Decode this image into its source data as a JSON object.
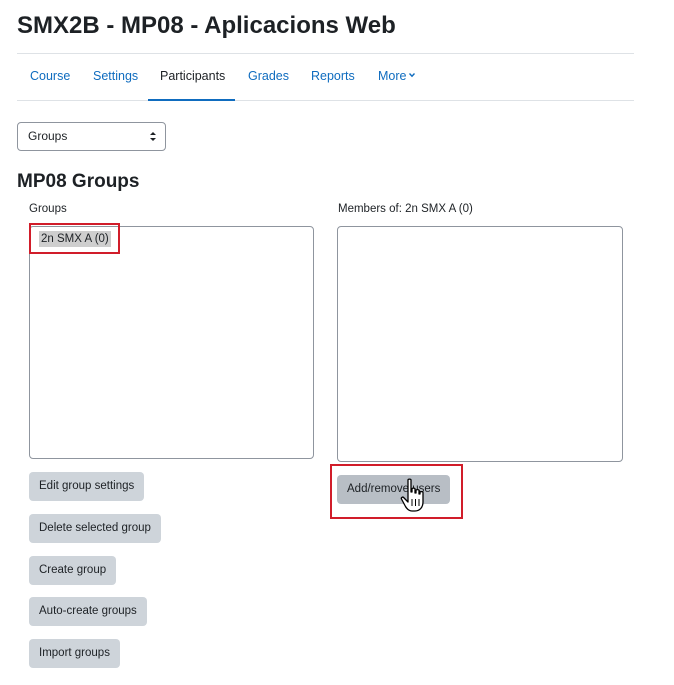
{
  "course": {
    "title": "SMX2B - MP08 - Aplicacions Web"
  },
  "nav": {
    "tabs": {
      "course": "Course",
      "settings": "Settings",
      "participants": "Participants",
      "grades": "Grades",
      "reports": "Reports",
      "more": "More"
    },
    "active_tab": "Participants"
  },
  "groups_select": {
    "value": "Groups"
  },
  "section": {
    "title": "MP08 Groups"
  },
  "groups_list": {
    "label": "Groups",
    "selected": "2n SMX A (0)"
  },
  "members_list": {
    "label": "Members of: 2n SMX A (0)"
  },
  "buttons": {
    "edit_group_settings": "Edit group settings",
    "delete_selected_group": "Delete selected group",
    "create_group": "Create group",
    "auto_create_groups": "Auto-create groups",
    "import_groups": "Import groups",
    "add_remove_users": "Add/remove users"
  },
  "colors": {
    "link": "#0f6cbf",
    "button_bg": "#ced4da",
    "highlight_border": "#d11d2a",
    "selected_option_bg": "#cecece"
  },
  "icons": {
    "more_dropdown": "chevron-down-icon",
    "select_arrows": "sort-arrows-icon",
    "pointer": "hand-pointer-icon"
  }
}
